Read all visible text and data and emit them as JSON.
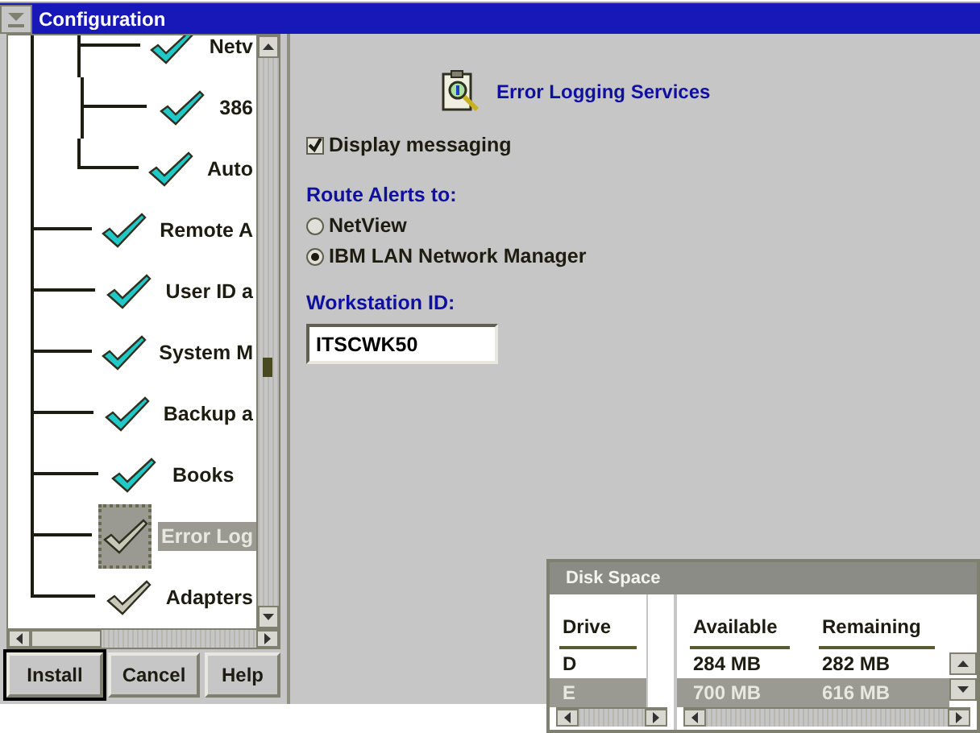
{
  "window": {
    "title": "Configuration"
  },
  "tree": {
    "items": [
      {
        "children": [
          {
            "label": "Netv",
            "installed": true,
            "selected": false
          },
          {
            "label": "386",
            "installed": true,
            "selected": false
          },
          {
            "label": "Auto",
            "installed": true,
            "selected": false
          }
        ]
      },
      {
        "label": "Remote A",
        "installed": true,
        "selected": false
      },
      {
        "label": "User ID a",
        "installed": true,
        "selected": false
      },
      {
        "label": "System M",
        "installed": true,
        "selected": false
      },
      {
        "label": "Backup a",
        "installed": true,
        "selected": false
      },
      {
        "label": "Books",
        "installed": true,
        "selected": false
      },
      {
        "label": "Error Log",
        "installed": false,
        "selected": true
      },
      {
        "label": "Adapters",
        "installed": false,
        "selected": false
      }
    ]
  },
  "buttons": [
    {
      "label": "Install",
      "focused": true
    },
    {
      "label": "Cancel",
      "focused": false
    },
    {
      "label": "Help",
      "focused": false
    }
  ],
  "details": {
    "title": "Error Logging Services",
    "display_messaging": {
      "label": "Display messaging",
      "checked": true
    },
    "route_label": "Route Alerts to:",
    "route_options": [
      {
        "label": "NetView",
        "selected": false
      },
      {
        "label": "IBM LAN Network Manager",
        "selected": true
      }
    ],
    "workstation_label": "Workstation ID:",
    "workstation_id": "ITSCWK50"
  },
  "disk_space": {
    "title": "Disk Space",
    "columns": [
      "Drive",
      "Available",
      "Remaining"
    ],
    "rows": [
      {
        "drive": "D",
        "available": "284 MB",
        "remaining": "282 MB",
        "selected": false
      },
      {
        "drive": "E",
        "available": "700 MB",
        "remaining": "616 MB",
        "selected": true
      }
    ]
  }
}
